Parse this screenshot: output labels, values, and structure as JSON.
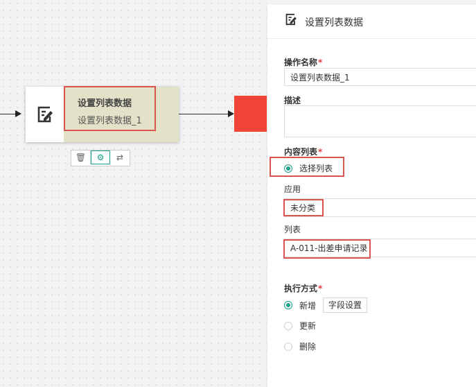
{
  "flow": {
    "node": {
      "title": "设置列表数据",
      "subtitle": "设置列表数据_1"
    },
    "node_tools": [
      {
        "name": "delete",
        "glyph": "🗑"
      },
      {
        "name": "settings",
        "glyph": "⚙"
      },
      {
        "name": "switch",
        "glyph": "⇄"
      }
    ],
    "colors": {
      "accent": "#1aa08c",
      "next_node": "#f04438",
      "highlight": "#d9534f",
      "node_label_bg": "#e3e2c8"
    }
  },
  "panel": {
    "title": "设置列表数据",
    "operation_name": {
      "label": "操作名称",
      "value": "设置列表数据_1"
    },
    "description": {
      "label": "描述",
      "value": ""
    },
    "content_list": {
      "label": "内容列表",
      "option": "选择列表"
    },
    "application": {
      "label": "应用",
      "value": "未分类"
    },
    "list": {
      "label": "列表",
      "value": "A-011-出差申请记录"
    },
    "execution": {
      "label": "执行方式",
      "options": [
        {
          "label": "新增",
          "selected": true
        },
        {
          "label": "更新",
          "selected": false
        },
        {
          "label": "删除",
          "selected": false
        }
      ],
      "field_settings_button": "字段设置"
    },
    "required_mark": "*"
  }
}
